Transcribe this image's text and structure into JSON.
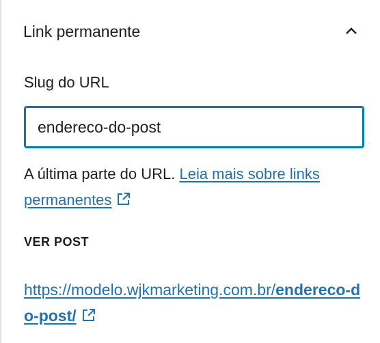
{
  "panel": {
    "title": "Link permanente",
    "collapse_icon": "chevron-up-icon"
  },
  "slug": {
    "label": "Slug do URL",
    "value": "endereco-do-post"
  },
  "help": {
    "text": "A última parte do URL.",
    "link_text": "Leia mais sobre links permanentes",
    "link_icon": "external-link-icon"
  },
  "view_post": {
    "label": "VER POST",
    "url_prefix": "https://modelo.wjkmarketing.com.br/",
    "url_slug": "endereco-do-post/",
    "link_icon": "external-link-icon"
  },
  "colors": {
    "link": "#2271b1",
    "focus_border": "#007cba",
    "text": "#1e1e1e",
    "divider": "#e0e0e0"
  }
}
